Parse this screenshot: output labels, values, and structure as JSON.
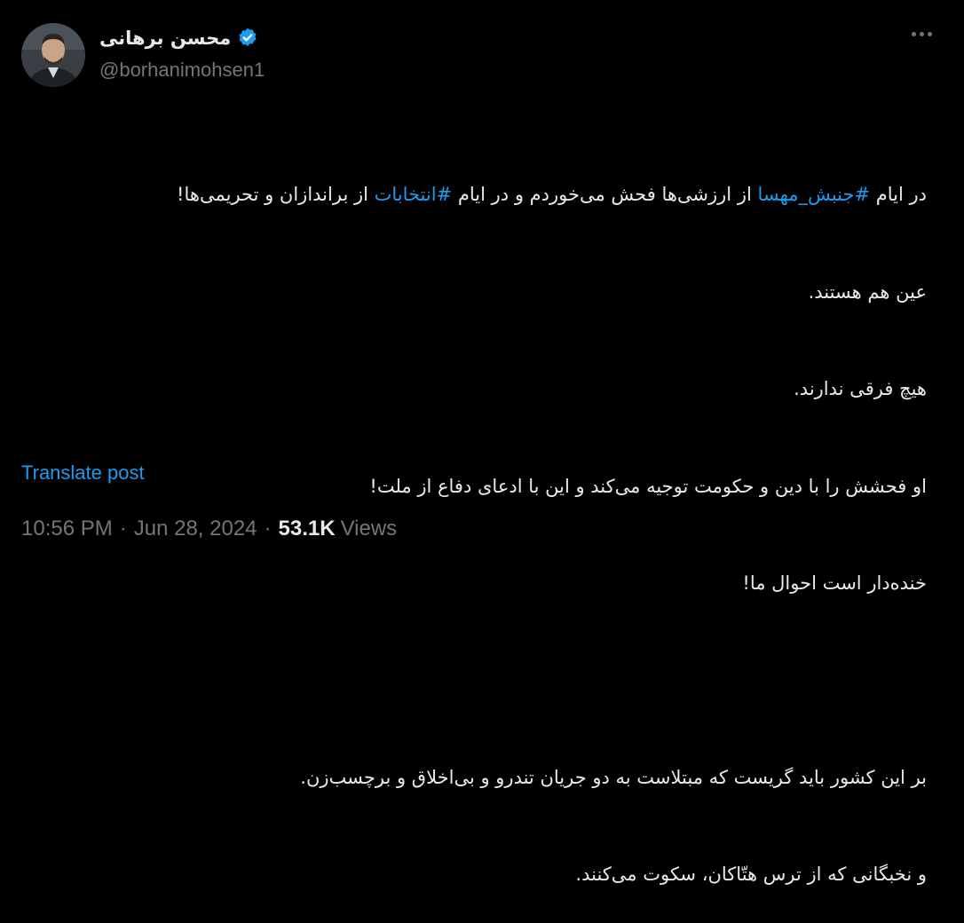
{
  "author": {
    "display_name": "محسن برهانی",
    "handle": "@borhanimohsen1",
    "verified": true,
    "avatar": "profile-photo"
  },
  "colors": {
    "background": "#000000",
    "text": "#e7e9ea",
    "muted": "#71767b",
    "accent": "#1d9bf0"
  },
  "tweet": {
    "line1_part1": "در ایام ",
    "hashtag1": "#جنبش_مهسا",
    "line1_part2": " از ارزشی‌ها فحش می‌خوردم و در ایام ",
    "hashtag2": "#انتخابات",
    "line1_part3": " از براندازان و تحریمی‌ها!",
    "line2": "عین هم هستند.",
    "line3": "هیچ فرقی ندارند.",
    "line4": "او فحشش را با دین و حکومت توجیه می‌کند و این با ادعای دفاع از ملت!",
    "line5": "خنده‌دار است احوال ما!",
    "line6": "بر این کشور باید گریست که مبتلاست به دو جریان تندرو و بی‌اخلاق و برچسب‌زن.",
    "line7": "و نخبگانی که از ترس هتّاکان، سکوت می‌کنند."
  },
  "translate_label": "Translate post",
  "meta": {
    "time": "10:56 PM",
    "separator": "·",
    "date": "Jun 28, 2024",
    "views_count": "53.1K",
    "views_label": "Views"
  },
  "icons": {
    "more": "more-dots-icon",
    "verified": "verified-badge-icon"
  }
}
